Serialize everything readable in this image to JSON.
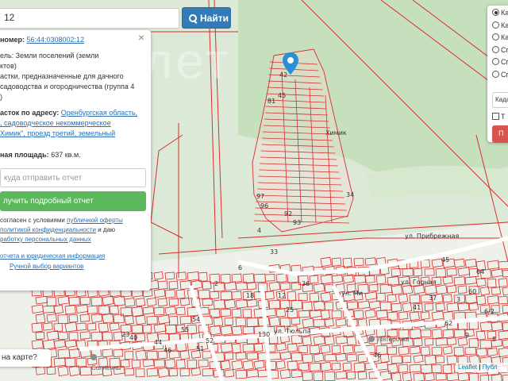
{
  "search": {
    "value": "12",
    "button_label": "Найти"
  },
  "info_panel": {
    "cadastral_label": "номер:",
    "cadastral_number": "56:44:0308002:12",
    "category_line1": "ель: Земли поселений (земли",
    "category_line2": "ктов)",
    "use_line1": "астки, предназначенные для дачного",
    "use_line2": "садоводства и огородничества (группа 4",
    "use_line3": ")",
    "address_label": "асток по адресу:",
    "address_link1": "Оренбургская область,",
    "address_link2": ", садоводческое некоммерческое",
    "address_link3": "Химик\", проезд третий, земельный",
    "area_label": "ная площадь:",
    "area_value": "637 кв.м.",
    "report_placeholder": "куда отправить отчет",
    "detail_button": "лучить подробный отчет",
    "consent_line1_a": "согласен с условиями",
    "consent_line1_link": "публичной оферты",
    "consent_line2_link": "политикой конфиденциальности",
    "consent_line2_b": "и даю",
    "consent_line3_link": "работку персональных данных",
    "link_report": "отчета и юридическая информация",
    "link_manual": "Ручной выбор вариантов"
  },
  "layers": {
    "options": [
      "Ка",
      "Ка",
      "Ка",
      "Сп",
      "Сп",
      "Сп"
    ],
    "selected_index": 0,
    "select_value": "Кадас",
    "checkbox_label": "Т",
    "red_button": "П"
  },
  "question_label": "на карте?",
  "attribution": {
    "leaflet": "Leaflet",
    "separator": "|",
    "rest": "Публ"
  },
  "map_labels": {
    "snt_khimik": "Химик",
    "street_tulpan": "ул. Тюльпа",
    "street_gornaya": "ул. Горная",
    "street_pribrezhnaya": "ул. Прибрежная",
    "street_mikh": "ул. Ми",
    "poi_pyaterochka": "Пятёрочка",
    "poi_solnechny": "Солнечны"
  },
  "plot_numbers": [
    "81",
    "45",
    "42",
    "97",
    "96",
    "92",
    "93",
    "34",
    "4",
    "54",
    "55",
    "52",
    "51",
    "46",
    "44",
    "40",
    "23",
    "130",
    "33",
    "36",
    "25",
    "12",
    "18",
    "2",
    "6",
    "41",
    "37",
    "60",
    "64",
    "62",
    "46",
    "45",
    "3",
    "6/2",
    "8",
    "9"
  ],
  "colors": {
    "parcel_stroke": "#d62f2f",
    "map_bg": "#dde9d7",
    "forest": "#c8e2bf",
    "search_button": "#337ab7",
    "detail_button": "#5cb85c",
    "red_button": "#d9534f",
    "link": "#2a6fb3",
    "pin": "#2c8fd6"
  }
}
